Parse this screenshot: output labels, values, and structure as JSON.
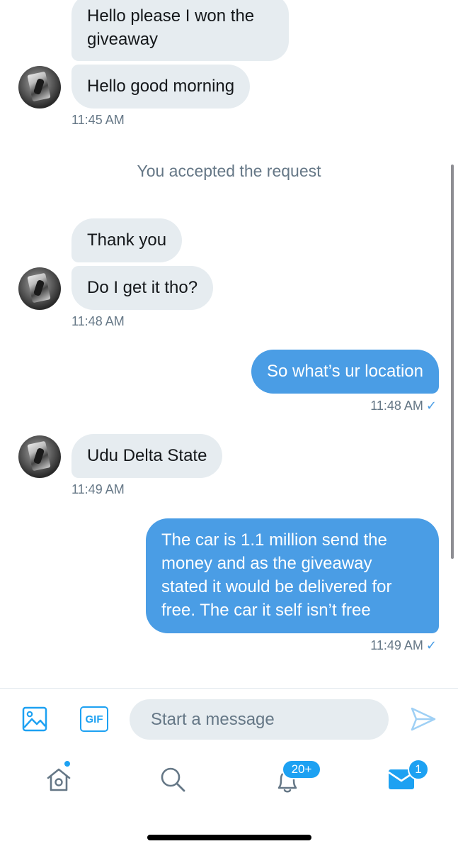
{
  "conversation": {
    "group1": {
      "messages": [
        "Hello please I won the\ngiveaway",
        "Hello good morning"
      ],
      "timestamp": "11:45 AM"
    },
    "system_note": "You accepted the request",
    "group2": {
      "messages": [
        "Thank you",
        "Do I get it tho?"
      ],
      "timestamp": "11:48 AM"
    },
    "sent1": {
      "text": "So what’s ur location",
      "timestamp": "11:48 AM",
      "status": "✓"
    },
    "group3": {
      "messages": [
        "Udu Delta State"
      ],
      "timestamp": "11:49 AM"
    },
    "sent2": {
      "text": "The car is 1.1 million send the\nmoney and as the giveaway\nstated it would be delivered for\nfree. The car it self isn’t free",
      "timestamp": "11:49 AM",
      "status": "✓"
    }
  },
  "composer": {
    "image_icon": "image-icon",
    "gif_label": "GIF",
    "placeholder": "Start a message",
    "send_icon": "send-icon"
  },
  "tabbar": {
    "home": {
      "icon": "home-icon",
      "has_dot": true
    },
    "search": {
      "icon": "search-icon"
    },
    "notifications": {
      "icon": "bell-icon",
      "badge": "20+"
    },
    "messages": {
      "icon": "mail-icon",
      "badge": "1"
    }
  },
  "colors": {
    "accent": "#1da1f2",
    "sent_bubble": "#4a9de5",
    "received_bubble": "#e6ecf0",
    "secondary_text": "#657786"
  }
}
